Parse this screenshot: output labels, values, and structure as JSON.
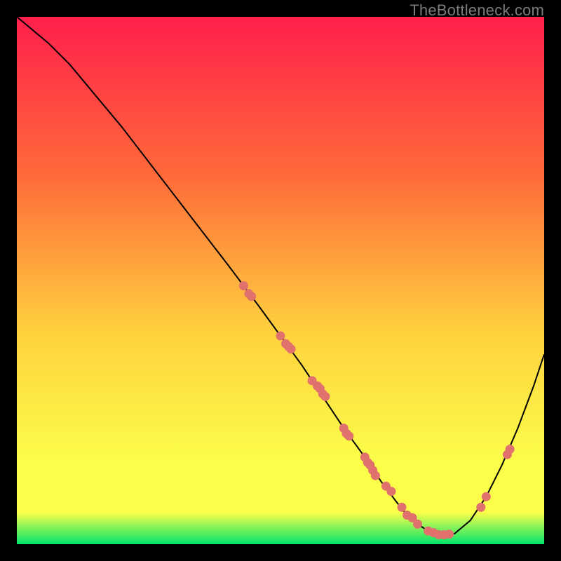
{
  "watermark": "TheBottleneck.com",
  "colors": {
    "gradient_top": "#ff1f4b",
    "gradient_mid1": "#ff6a3a",
    "gradient_mid2": "#ffd23e",
    "gradient_mid3": "#fbff4a",
    "gradient_bottom": "#00e46a",
    "curve": "#000000",
    "marker": "#e0716c",
    "frame": "#000000"
  },
  "chart_data": {
    "type": "line",
    "title": "",
    "xlabel": "",
    "ylabel": "",
    "xlim": [
      0,
      100
    ],
    "ylim": [
      0,
      100
    ],
    "curve": {
      "x": [
        0,
        3,
        6,
        10,
        15,
        20,
        25,
        30,
        35,
        40,
        43,
        46,
        50,
        54,
        58,
        62,
        66,
        69,
        72,
        74,
        76,
        78,
        80,
        83,
        86,
        89,
        92,
        95,
        98,
        100
      ],
      "y": [
        100,
        97.5,
        95,
        91,
        85,
        79,
        72.5,
        66,
        59.5,
        53,
        49,
        45,
        39.5,
        34,
        28,
        22,
        16.5,
        12,
        8,
        5.5,
        3.8,
        2.5,
        1.8,
        2.0,
        4.5,
        9,
        15,
        22,
        30,
        36
      ]
    },
    "markers": {
      "x": [
        43,
        44,
        44.5,
        50,
        51,
        51.5,
        52,
        56,
        57,
        57.5,
        58,
        58.5,
        62,
        62.5,
        63,
        66,
        66.5,
        67,
        67.5,
        68,
        70,
        71,
        73,
        74,
        75,
        76,
        78,
        79,
        80,
        81,
        82,
        88,
        89,
        93,
        93.5
      ],
      "y": [
        49,
        47.5,
        47,
        39.5,
        38,
        37.5,
        37,
        31,
        30,
        29.5,
        28.5,
        28,
        22,
        21,
        20.5,
        16.5,
        15.5,
        15,
        14,
        13,
        11,
        10,
        7,
        5.5,
        5,
        3.8,
        2.5,
        2.2,
        1.8,
        1.8,
        1.9,
        7,
        9,
        17,
        18
      ]
    }
  }
}
